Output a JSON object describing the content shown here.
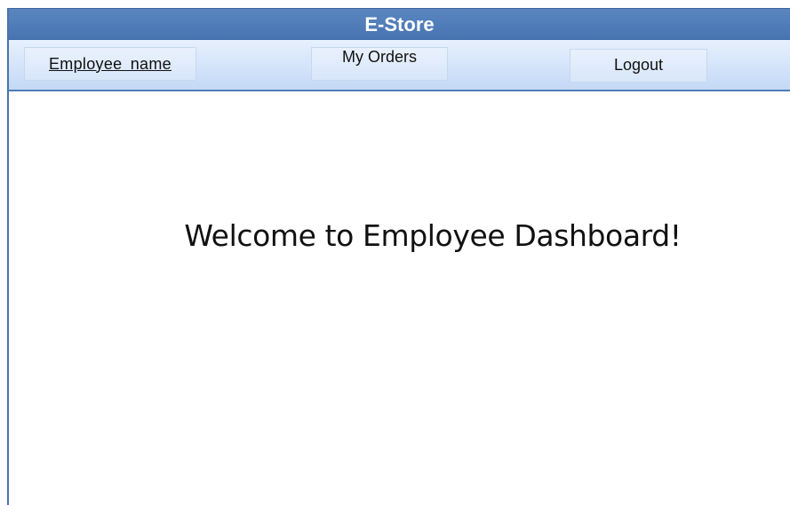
{
  "app": {
    "title": "E-Store"
  },
  "nav": {
    "employee_name": "Employee  name",
    "my_orders": "My Orders",
    "logout": "Logout"
  },
  "main": {
    "welcome": "Welcome to Employee Dashboard!"
  },
  "colors": {
    "title_bar": "#4f7cb8",
    "nav_bar": "#d7e6fb",
    "accent_border": "#4a74ab"
  }
}
